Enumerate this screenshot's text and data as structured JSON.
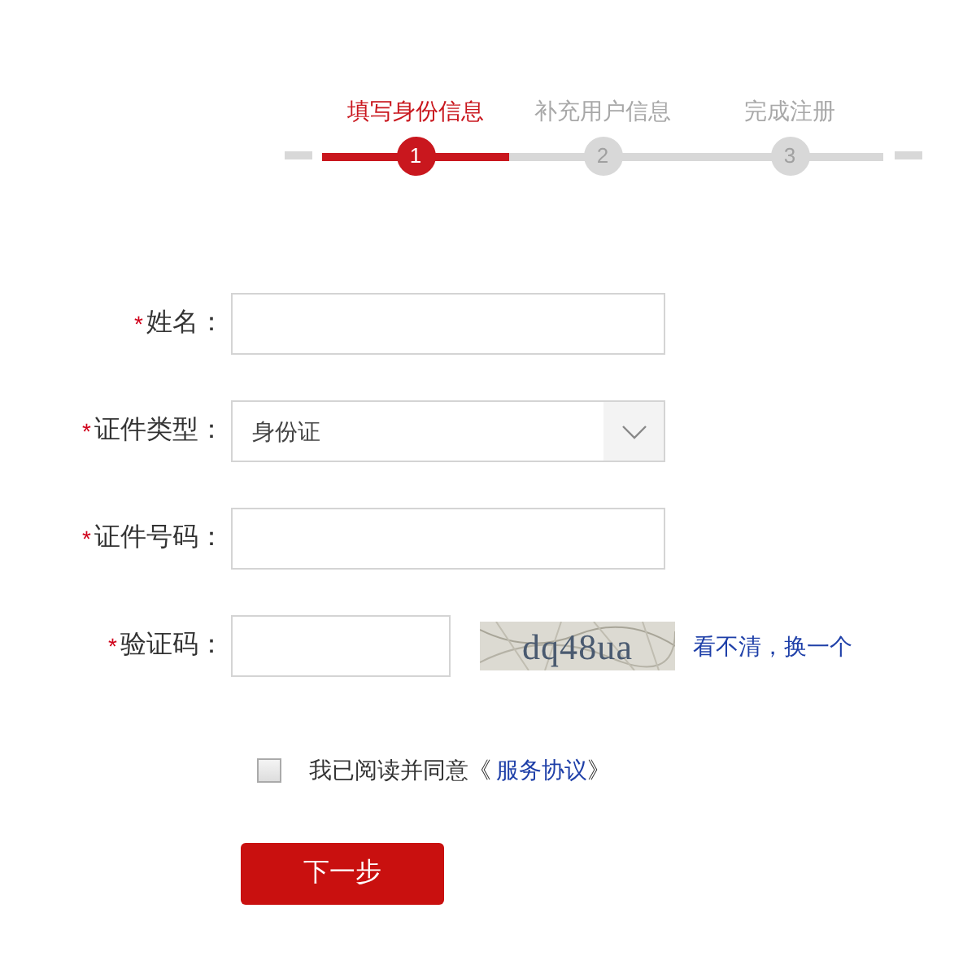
{
  "steps": [
    {
      "label": "填写身份信息",
      "number": "1",
      "selected": true
    },
    {
      "label": "补充用户信息",
      "number": "2",
      "selected": false
    },
    {
      "label": "完成注册",
      "number": "3",
      "selected": false
    }
  ],
  "fields": [
    {
      "kind": "text",
      "label": "姓名：",
      "required": true
    },
    {
      "kind": "select",
      "label": "证件类型：",
      "required": true,
      "value": "身份证"
    },
    {
      "kind": "text",
      "label": "证件号码：",
      "required": true
    },
    {
      "kind": "captcha",
      "label": "验证码：",
      "required": true,
      "captcha": "dq48ua",
      "refresh_link": "看不清，换一个"
    }
  ],
  "required_mark": "*",
  "agreement": {
    "checked": false,
    "text": "我已阅读并同意《",
    "link": "服务协议",
    "closing": "》"
  },
  "submit": "下一步"
}
